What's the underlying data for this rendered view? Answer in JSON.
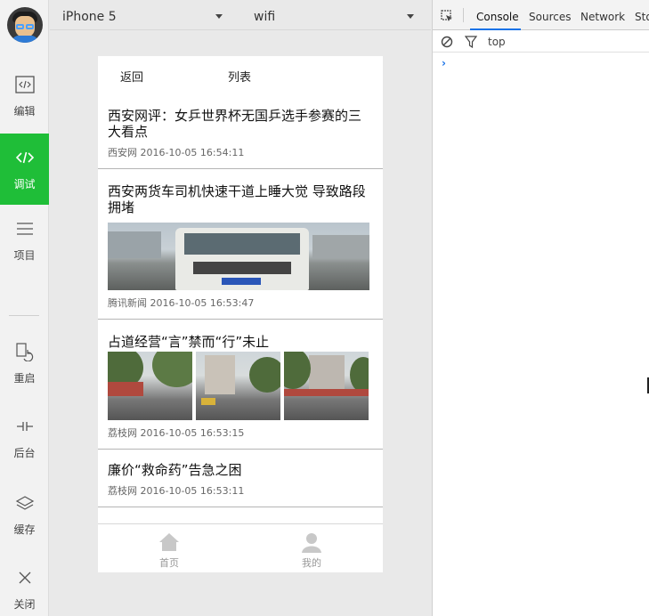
{
  "toolbar": {
    "items": [
      {
        "label": "编辑",
        "icon": "code-box-icon"
      },
      {
        "label": "调试",
        "icon": "debug-code-icon",
        "active": true
      },
      {
        "label": "项目",
        "icon": "menu-lines-icon"
      },
      {
        "label": "重启",
        "icon": "restart-icon"
      },
      {
        "label": "后台",
        "icon": "background-icon"
      },
      {
        "label": "缓存",
        "icon": "layers-icon"
      },
      {
        "label": "关闭",
        "icon": "close-icon"
      }
    ],
    "active_color": "#1fbe38"
  },
  "device_bar": {
    "device": "iPhone 5",
    "network": "wifi"
  },
  "phone": {
    "nav": {
      "back": "返回",
      "title": "列表"
    },
    "news": [
      {
        "title": "西安网评：女乒世界杯无国乒选手参赛的三大看点",
        "source": "西安网",
        "time": "2016-10-05 16:54:11"
      },
      {
        "title": "西安两货车司机快速干道上睡大觉 导致路段拥堵",
        "source": "腾讯新闻",
        "time": "2016-10-05 16:53:47"
      },
      {
        "title": "占道经营“言”禁而“行”未止",
        "source": "荔枝网",
        "time": "2016-10-05 16:53:15"
      },
      {
        "title": "廉价“救命药”告急之困",
        "source": "荔枝网",
        "time": "2016-10-05 16:53:11"
      }
    ],
    "tabbar": [
      {
        "label": "首页",
        "icon": "home-icon"
      },
      {
        "label": "我的",
        "icon": "user-icon"
      }
    ]
  },
  "devtools": {
    "tabs": [
      "Console",
      "Sources",
      "Network",
      "Sto"
    ],
    "active_tab": "Console",
    "context": "top",
    "accent": "#1a73e8"
  }
}
